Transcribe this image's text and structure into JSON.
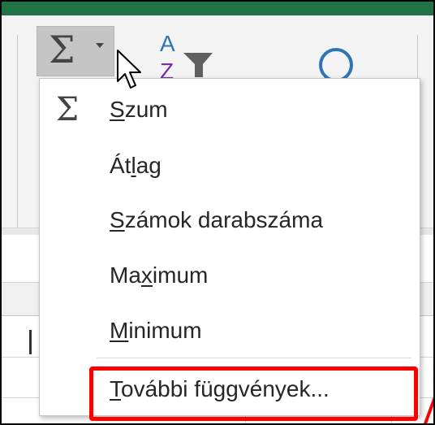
{
  "window": {
    "title_bar_color": "#217346"
  },
  "ribbon": {
    "autosum_button": {
      "symbol": "Σ",
      "icon": "sigma-icon",
      "dropdown_icon": "caret-down-icon"
    },
    "sort_filter_button": {
      "letter_a": "A",
      "letter_z": "Z",
      "icon": "sort-filter-icon"
    },
    "find_select_button": {
      "icon": "magnifier-icon"
    }
  },
  "autosum_menu": {
    "items": [
      {
        "label_pre": "",
        "label_key": "S",
        "label_post": "zum",
        "label": "Szum",
        "icon": "sigma-icon",
        "icon_symbol": "Σ"
      },
      {
        "label_pre": "Át",
        "label_key": "l",
        "label_post": "ag",
        "label": "Átlag"
      },
      {
        "label_pre": "",
        "label_key": "S",
        "label_post": "zámok darabszáma",
        "label": "Számok darabszáma"
      },
      {
        "label_pre": "Ma",
        "label_key": "x",
        "label_post": "imum",
        "label": "Maximum"
      },
      {
        "label_pre": "",
        "label_key": "M",
        "label_post": "inimum",
        "label": "Minimum"
      },
      {
        "label_pre": "",
        "label_key": "T",
        "label_post": "ovábbi függvények...",
        "label": "További függvények...",
        "highlighted": true
      }
    ],
    "highlight_color": "#ff0000"
  },
  "colors": {
    "accent_green": "#217346",
    "highlight_red": "#ff0000",
    "menu_text": "#262626"
  }
}
